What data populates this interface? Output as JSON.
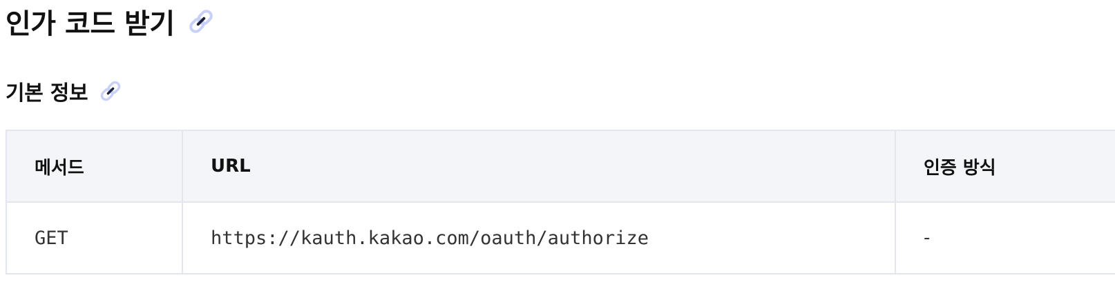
{
  "section": {
    "title": "인가 코드 받기",
    "anchor_icon": "link-icon"
  },
  "subsection": {
    "title": "기본 정보",
    "anchor_icon": "link-icon"
  },
  "table": {
    "headers": [
      "메서드",
      "URL",
      "인증 방식"
    ],
    "rows": [
      [
        "GET",
        "https://kauth.kakao.com/oauth/authorize",
        "-"
      ]
    ]
  },
  "colors": {
    "header_bg": "#f4f5f9",
    "border": "#e4e6ee",
    "link_icon_light": "#c9d0f7",
    "link_icon_dark": "#1a1f36"
  }
}
